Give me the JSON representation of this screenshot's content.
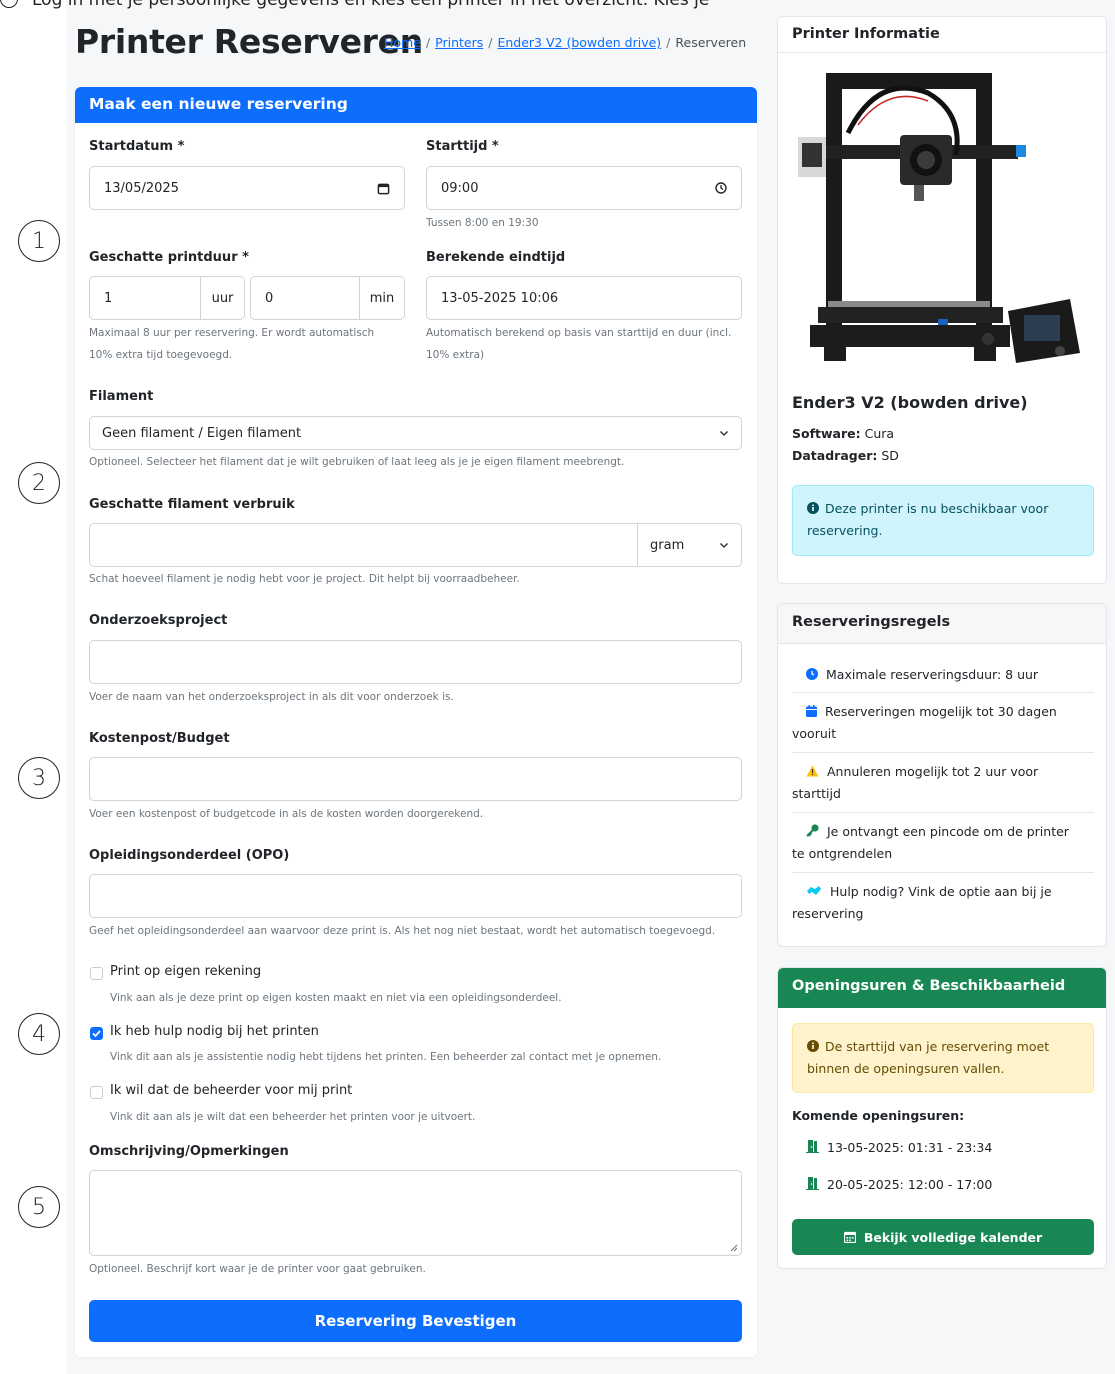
{
  "page": {
    "title": "Printer Reserveren",
    "top_cut_text": "Log in met je persoonlijke gegevens en kies een printer in het overzicht. Kies je"
  },
  "markers": [
    "1",
    "2",
    "3",
    "4",
    "5"
  ],
  "breadcrumb": [
    {
      "label": "Home"
    },
    {
      "label": "Printers"
    },
    {
      "label": "Ender3 V2 (bowden drive)"
    },
    {
      "label": "Reserveren"
    }
  ],
  "form": {
    "header": "Maak een nieuwe reservering",
    "startdatum": {
      "label": "Startdatum *",
      "value": "13/05/2025"
    },
    "starttijd": {
      "label": "Starttijd *",
      "value": "09:00",
      "hint": "Tussen 8:00 en 19:30"
    },
    "duur": {
      "label": "Geschatte printduur *",
      "hours": "1",
      "hours_unit": "uur",
      "minutes": "0",
      "minutes_unit": "min",
      "hint_1": "Maximaal 8 uur per reservering. Er wordt automatisch",
      "hint_2": "10% extra tijd toegevoegd."
    },
    "eindtijd": {
      "label": "Berekende eindtijd",
      "value": "13-05-2025 10:06",
      "hint_1": "Automatisch berekend op basis van starttijd en duur (incl.",
      "hint_2": "10% extra)"
    },
    "filament": {
      "label": "Filament",
      "value": "Geen filament / Eigen filament",
      "hint": "Optioneel. Selecteer het filament dat je wilt gebruiken of laat leeg als je je eigen filament meebrengt."
    },
    "verbruik": {
      "label": "Geschatte filament verbruik",
      "value": "",
      "unit": "gram",
      "hint": "Schat hoeveel filament je nodig hebt voor je project. Dit helpt bij voorraadbeheer."
    },
    "onderzoek": {
      "label": "Onderzoeksproject",
      "value": "",
      "hint": "Voer de naam van het onderzoeksproject in als dit voor onderzoek is."
    },
    "kostenpost": {
      "label": "Kostenpost/Budget",
      "value": "",
      "hint": "Voer een kostenpost of budgetcode in als de kosten worden doorgerekend."
    },
    "opo": {
      "label": "Opleidingsonderdeel (OPO)",
      "value": "",
      "hint": "Geef het opleidingsonderdeel aan waarvoor deze print is. Als het nog niet bestaat, wordt het automatisch toegevoegd."
    },
    "checks": [
      {
        "label": "Print op eigen rekening",
        "hint": "Vink aan als je deze print op eigen kosten maakt en niet via een opleidingsonderdeel.",
        "checked": false
      },
      {
        "label": "Ik heb hulp nodig bij het printen",
        "hint": "Vink dit aan als je assistentie nodig hebt tijdens het printen. Een beheerder zal contact met je opnemen.",
        "checked": true
      },
      {
        "label": "Ik wil dat de beheerder voor mij print",
        "hint": "Vink dit aan als je wilt dat een beheerder het printen voor je uitvoert.",
        "checked": false
      }
    ],
    "omschrijving": {
      "label": "Omschrijving/Opmerkingen",
      "value": "",
      "hint": "Optioneel. Beschrijf kort waar je de printer voor gaat gebruiken."
    },
    "submit_label": "Reservering Bevestigen"
  },
  "printer_info": {
    "header": "Printer Informatie",
    "name": "Ender3 V2 (bowden drive)",
    "software_label": "Software:",
    "software_value": "Cura",
    "datadrager_label": "Datadrager:",
    "datadrager_value": "SD",
    "alert_1": "Deze printer is nu beschikbaar voor",
    "alert_2": "reservering."
  },
  "rules": {
    "header": "Reserveringsregels",
    "items": [
      {
        "icon": "clock-icon",
        "line1": "Maximale reserveringsduur: 8 uur",
        "line2": ""
      },
      {
        "icon": "calendar-icon",
        "line1": "Reserveringen mogelijk tot 30 dagen",
        "line2": "vooruit"
      },
      {
        "icon": "warning-icon",
        "line1": "Annuleren mogelijk tot 2 uur voor",
        "line2": "starttijd"
      },
      {
        "icon": "key-icon",
        "line1": "Je ontvangt een pincode om de printer",
        "line2": "te ontgrendelen"
      },
      {
        "icon": "handshake-icon",
        "line1": "Hulp nodig? Vink de optie aan bij je",
        "line2": "reservering"
      }
    ]
  },
  "hours": {
    "header": "Openingsuren & Beschikbaarheid",
    "alert_1": "De starttijd van je reservering moet",
    "alert_2": "binnen de openingsuren vallen.",
    "upcoming_label": "Komende openingsuren:",
    "slots": [
      "13-05-2025: 01:31 - 23:34",
      "20-05-2025: 12:00 - 17:00"
    ],
    "calendar_button": "Bekijk volledige kalender"
  },
  "colors": {
    "primary": "#0d6efd",
    "success": "#198754",
    "info_bg": "#cff4fc",
    "warning_bg": "#fff3cd"
  }
}
